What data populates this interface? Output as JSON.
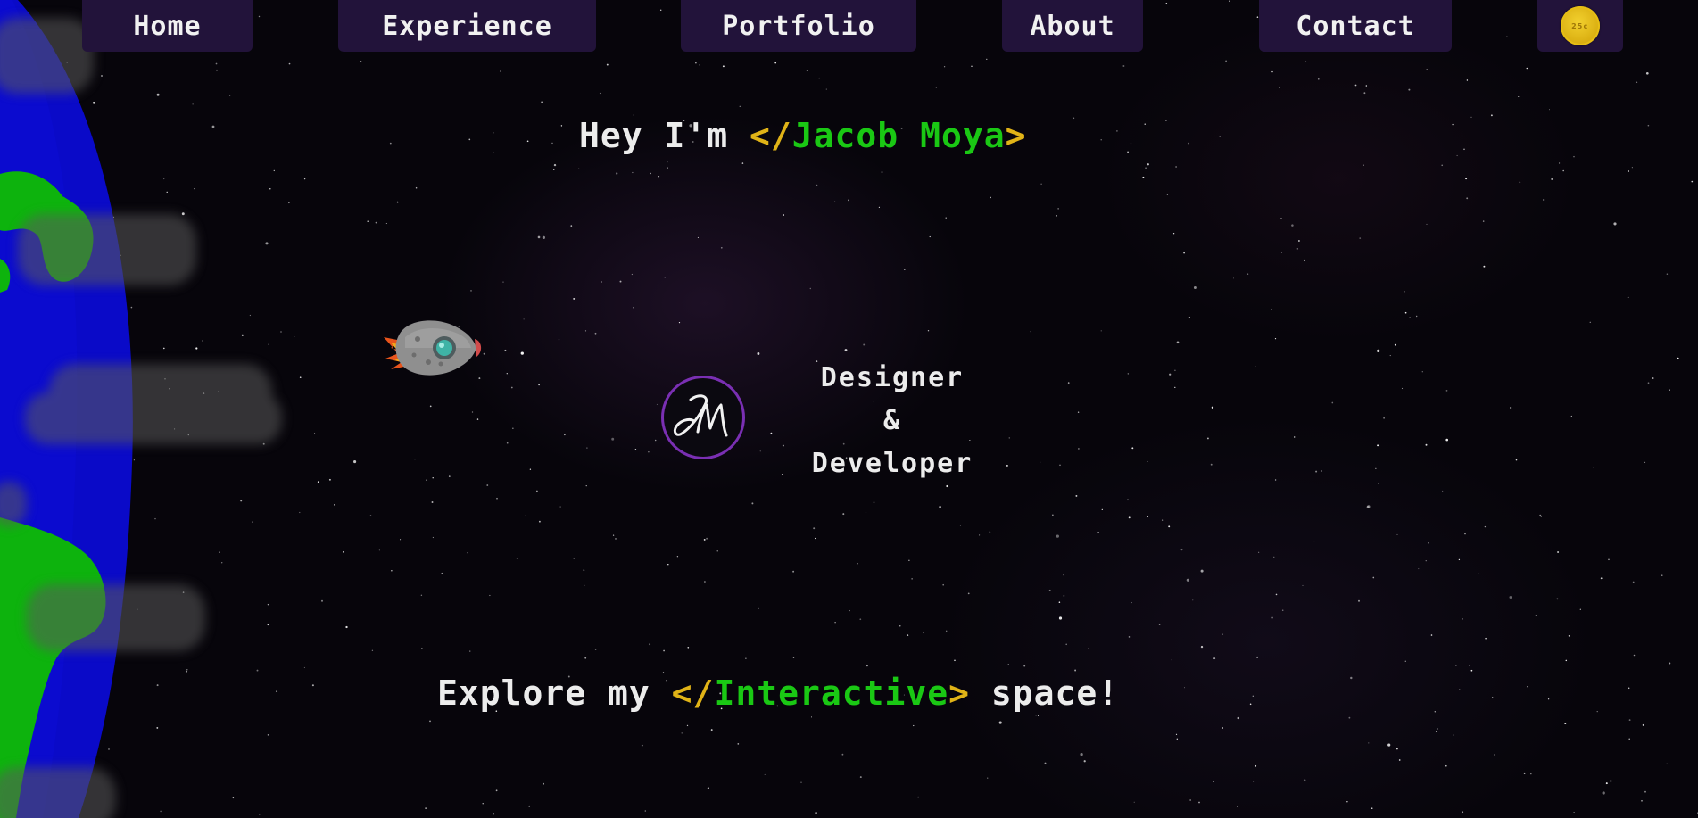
{
  "nav": {
    "items": [
      {
        "label": "Home"
      },
      {
        "label": "Experience"
      },
      {
        "label": "Portfolio"
      },
      {
        "label": "About"
      },
      {
        "label": "Contact"
      }
    ],
    "coin_label": "25¢"
  },
  "hero": {
    "greeting_prefix": "Hey I'm ",
    "name_open": "</",
    "name": "Jacob Moya",
    "name_close": ">",
    "role_line1": "Designer",
    "role_line2": "&",
    "role_line3": "Developer",
    "explore_prefix": "Explore my ",
    "explore_open": "</",
    "explore_word": "Interactive",
    "explore_close": ">",
    "explore_suffix": " space!"
  },
  "icons": {
    "logo": "jm-monogram-icon",
    "rocket": "rocket-icon",
    "planet": "planet-earth-icon",
    "coin": "coin-icon"
  },
  "colors": {
    "nav_bg": "#22133a",
    "bracket": "#e0b317",
    "accent_green": "#1ac814",
    "text": "#ececec",
    "logo_ring": "#7a2fb3",
    "planet_ocean": "#0a0ac8",
    "planet_land": "#0db30d",
    "coin": "#e0b317"
  }
}
